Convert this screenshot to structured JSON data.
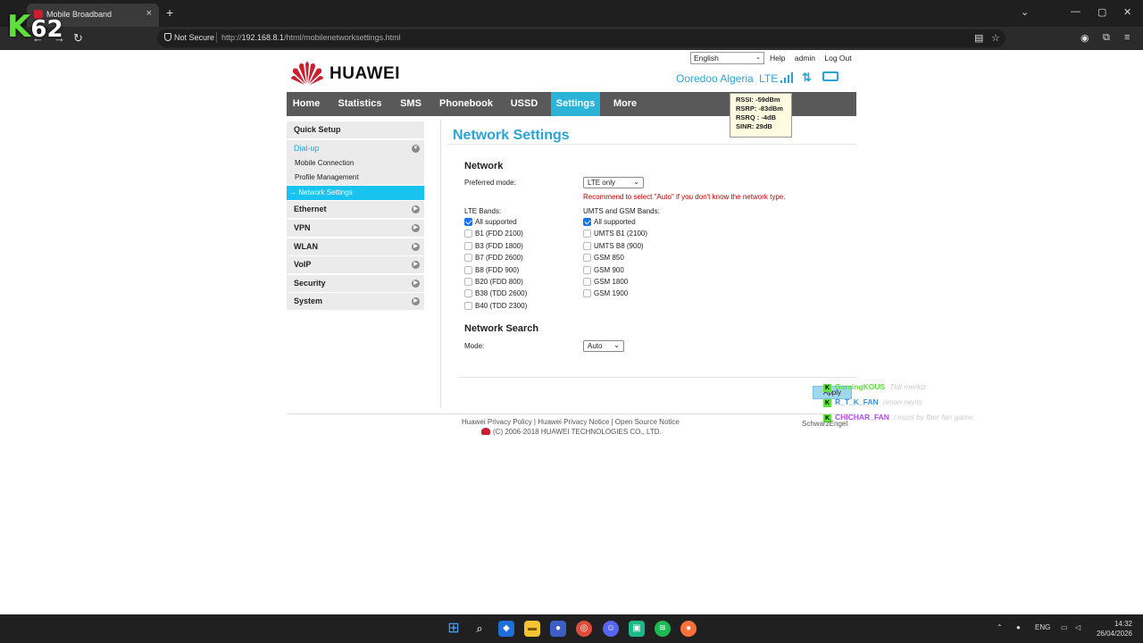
{
  "browser": {
    "tab_title": "Mobile Broadband",
    "tab_close": "×",
    "new_tab": "+",
    "not_secure": "Not Secure",
    "url_prefix": "http://",
    "url_host": "192.168.8.1",
    "url_path": "/html/mobilenetworksettings.html",
    "overlay_logo_k": "K",
    "overlay_logo_num": "62"
  },
  "header": {
    "brand": "HUAWEI",
    "language": "English",
    "help": "Help",
    "user": "admin",
    "logout": "Log Out",
    "operator": "Ooredoo Algeria",
    "network_type": "LTE",
    "tooltip": {
      "rssi": "RSSI: -59dBm",
      "rsrp": "RSRP: -83dBm",
      "rsrq": "RSRQ : -4dB",
      "sinr": "SINR: 29dB"
    }
  },
  "menu": {
    "home": "Home",
    "statistics": "Statistics",
    "sms": "SMS",
    "phonebook": "Phonebook",
    "ussd": "USSD",
    "settings": "Settings",
    "more": "More"
  },
  "sidebar": {
    "quick_setup": "Quick Setup",
    "dialup": "Dial-up",
    "mobile_connection": "Mobile Connection",
    "profile_management": "Profile Management",
    "network_settings": "→ Network Settings",
    "ethernet": "Ethernet",
    "vpn": "VPN",
    "wlan": "WLAN",
    "voip": "VoIP",
    "security": "Security",
    "system": "System"
  },
  "content": {
    "page_title": "Network Settings",
    "network_section": "Network",
    "preferred_mode_label": "Preferred mode:",
    "preferred_mode_value": "LTE only",
    "recommend": "Recommend to select \"Auto\" if you don't know the network type.",
    "lte_bands_label": "LTE Bands:",
    "umts_gsm_label": "UMTS and GSM Bands:",
    "lte_bands": [
      {
        "label": "All supported",
        "checked": true
      },
      {
        "label": "B1 (FDD 2100)",
        "checked": false
      },
      {
        "label": "B3 (FDD 1800)",
        "checked": false
      },
      {
        "label": "B7 (FDD 2600)",
        "checked": false
      },
      {
        "label": "B8 (FDD 900)",
        "checked": false
      },
      {
        "label": "B20 (FDD 800)",
        "checked": false
      },
      {
        "label": "B38 (TDD 2600)",
        "checked": false
      },
      {
        "label": "B40 (TDD 2300)",
        "checked": false
      }
    ],
    "umts_gsm_bands": [
      {
        "label": "All supported",
        "checked": true
      },
      {
        "label": "UMTS B1 (2100)",
        "checked": false
      },
      {
        "label": "UMTS B8 (900)",
        "checked": false
      },
      {
        "label": "GSM 850",
        "checked": false
      },
      {
        "label": "GSM 900",
        "checked": false
      },
      {
        "label": "GSM 1800",
        "checked": false
      },
      {
        "label": "GSM 1900",
        "checked": false
      }
    ],
    "network_search_section": "Network Search",
    "mode_label": "Mode:",
    "mode_value": "Auto",
    "apply": "Apply"
  },
  "footer": {
    "privacy_policy": "Huawei Privacy Policy",
    "privacy_notice": "Huawei Privacy Notice",
    "open_source": "Open Source Notice",
    "copyright": "(C) 2006-2018 HUAWEI TECHNOLOGIES CO., LTD."
  },
  "overlay_chat": [
    {
      "user": "GamingKOUS",
      "msg": "Tldl merkiz",
      "color": "#5ee03d"
    },
    {
      "user": "R_T_K_FAN",
      "msg": "rimon nerits",
      "color": "#3b8fe0"
    },
    {
      "user": "CHICHAR_FAN",
      "msg": "i must by fber fan game",
      "color": "#b04de0"
    }
  ],
  "overlay_credit": "SchwarzEngel",
  "taskbar": {
    "lang": "ENG",
    "time": "14:32",
    "date": "26/04/2026"
  },
  "colors": {
    "accent": "#2aa4d6",
    "menu_bg": "#595959",
    "active_tab": "#2cb3d8",
    "warning": "#c00000"
  }
}
